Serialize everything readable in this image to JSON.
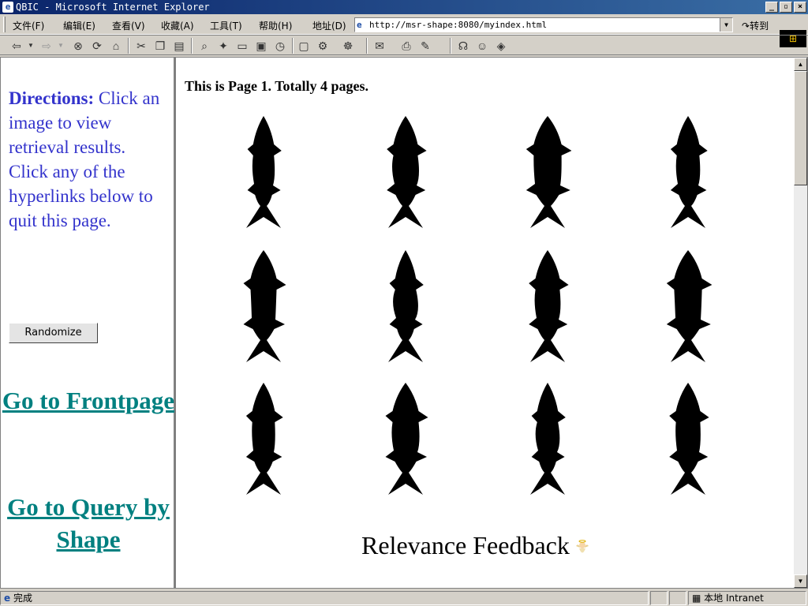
{
  "window": {
    "title": "QBIC - Microsoft Internet Explorer"
  },
  "menu": {
    "items": [
      "文件(F)",
      "编辑(E)",
      "查看(V)",
      "收藏(A)",
      "工具(T)",
      "帮助(H)"
    ]
  },
  "address": {
    "label": "地址(D)",
    "url": "http://msr-shape:8080/myindex.html",
    "go_label": "转到"
  },
  "left": {
    "directions_label": "Directions:",
    "directions_text": "Click an image to view retrieval results. Click any of the hyperlinks below to quit this page.",
    "randomize_label": "Randomize",
    "link_frontpage": "Go to Frontpage",
    "link_query": "Go to Query by Shape"
  },
  "main": {
    "page_info": "This is Page 1. Totally 4 pages.",
    "feedback_label": "Relevance Feedback",
    "thumbnail_count": 12
  },
  "status": {
    "text": "完成",
    "zone": "本地 Intranet"
  }
}
